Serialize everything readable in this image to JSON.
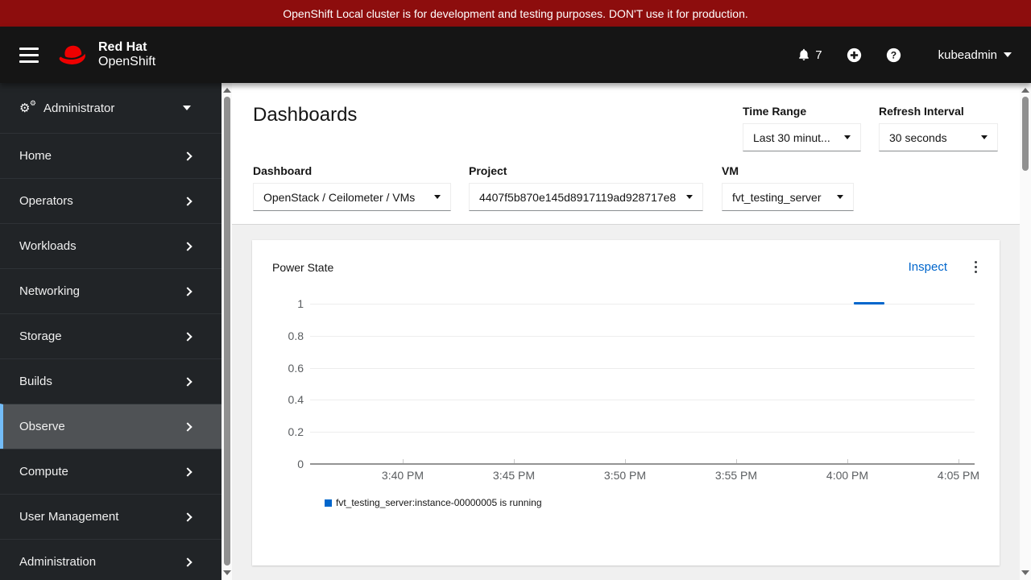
{
  "banner": {
    "text": "OpenShift Local cluster is for development and testing purposes. DON'T use it for production."
  },
  "header": {
    "brand_line1": "Red Hat",
    "brand_line2": "OpenShift",
    "notification_count": "7",
    "username": "kubeadmin"
  },
  "sidebar": {
    "perspective": {
      "label": "Administrator"
    },
    "items": [
      {
        "label": "Home"
      },
      {
        "label": "Operators"
      },
      {
        "label": "Workloads"
      },
      {
        "label": "Networking"
      },
      {
        "label": "Storage"
      },
      {
        "label": "Builds"
      },
      {
        "label": "Observe",
        "active": true
      },
      {
        "label": "Compute"
      },
      {
        "label": "User Management"
      },
      {
        "label": "Administration"
      }
    ]
  },
  "main": {
    "title": "Dashboards",
    "filters": {
      "time_range": {
        "label": "Time Range",
        "value": "Last 30 minut..."
      },
      "refresh_interval": {
        "label": "Refresh Interval",
        "value": "30 seconds"
      },
      "dashboard": {
        "label": "Dashboard",
        "value": "OpenStack / Ceilometer / VMs"
      },
      "project": {
        "label": "Project",
        "value": "4407f5b870e145d8917119ad928717e8"
      },
      "vm": {
        "label": "VM",
        "value": "fvt_testing_server"
      }
    },
    "card": {
      "title": "Power State",
      "inspect_label": "Inspect"
    }
  },
  "chart_data": {
    "type": "line",
    "title": "Power State",
    "xlabel": "",
    "ylabel": "",
    "x_ticks": [
      "3:40 PM",
      "3:45 PM",
      "3:50 PM",
      "3:55 PM",
      "4:00 PM",
      "4:05 PM"
    ],
    "y_ticks": [
      "1",
      "0.8",
      "0.6",
      "0.4",
      "0.2",
      "0"
    ],
    "ylim": [
      0,
      1
    ],
    "grid": true,
    "legend_position": "bottom-left",
    "series": [
      {
        "name": "fvt_testing_server:instance-00000005 is running",
        "color": "#0066cc",
        "points": [
          {
            "x": "4:00 PM",
            "y": 1
          },
          {
            "x": "4:02 PM",
            "y": 1
          }
        ]
      }
    ]
  },
  "colors": {
    "banner": "#8d0d0d",
    "masthead": "#151515",
    "sidebar": "#212427",
    "active_nav": "#4f5255",
    "active_nav_border": "#73bcf7",
    "link": "#0066cc",
    "series": "#0066cc",
    "page_bg": "#f0f0f0"
  }
}
